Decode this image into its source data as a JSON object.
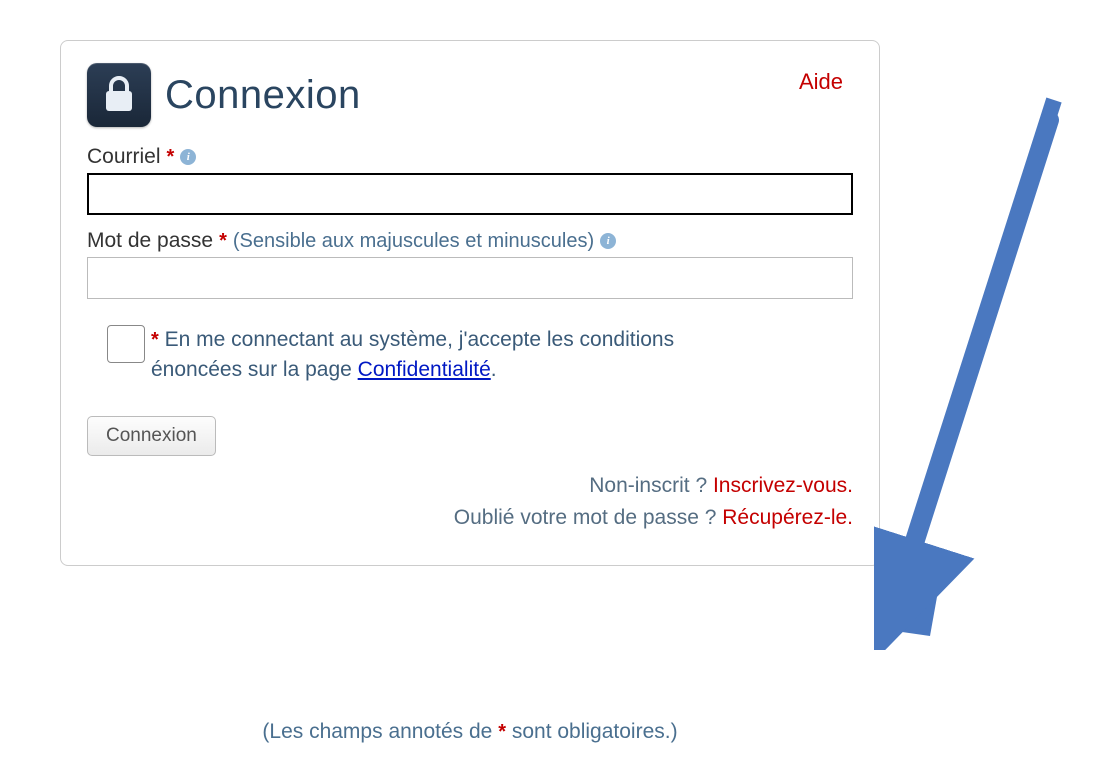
{
  "header": {
    "title": "Connexion",
    "help_label": "Aide"
  },
  "email": {
    "label": "Courriel",
    "value": ""
  },
  "password": {
    "label": "Mot de passe",
    "hint": "(Sensible aux majuscules et minuscules)",
    "value": ""
  },
  "consent": {
    "required_mark": "*",
    "text_a": " En me connectant au système, j'accepte les conditions énoncées sur la page ",
    "privacy_link": "Confidentialité",
    "text_b": "."
  },
  "submit_label": "Connexion",
  "footer": {
    "register_q": "Non-inscrit ? ",
    "register_link": "Inscrivez-vous.",
    "forgot_q": "Oublié votre mot de passe ? ",
    "forgot_link": "Récupérez-le."
  },
  "required_note": {
    "a": "(Les champs annotés de ",
    "star": "*",
    "b": " sont obligatoires.)"
  }
}
